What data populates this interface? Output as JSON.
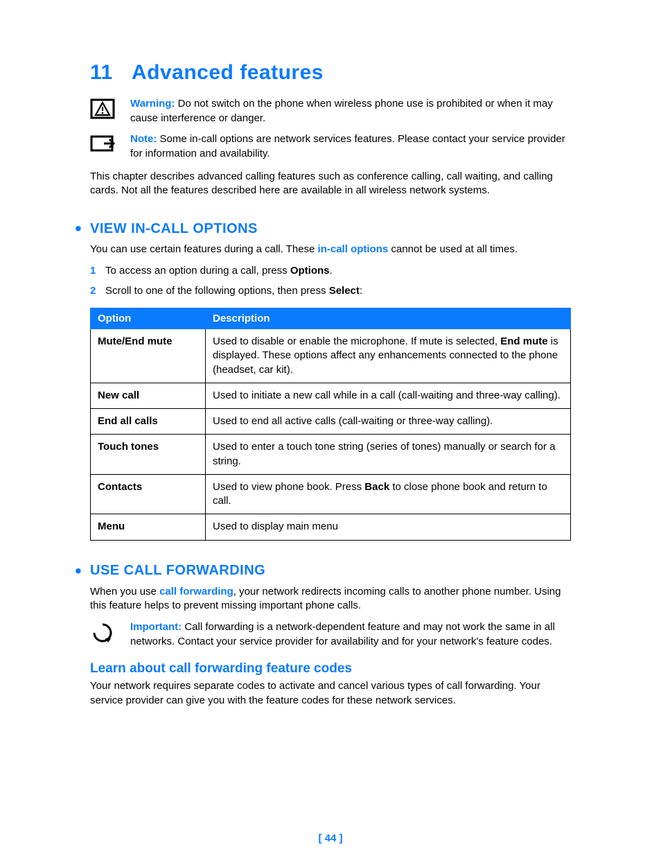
{
  "chapter": {
    "number": "11",
    "title": "Advanced features"
  },
  "warning": {
    "label": "Warning:",
    "text": " Do not switch on the phone when wireless phone use is prohibited or when it may cause interference or danger."
  },
  "note": {
    "label": "Note:",
    "text": " Some in-call options are network services features. Please contact your service provider for information and availability."
  },
  "intro": "This chapter describes advanced calling features such as conference calling, call waiting, and calling cards. Not all the features described here are available in all wireless network systems.",
  "section1": {
    "title": "VIEW IN-CALL OPTIONS",
    "body_pre": "You can use certain features during a call. These ",
    "body_term": "in-call options",
    "body_post": " cannot be used at all times.",
    "step1_pre": "To access an option during a call, press ",
    "step1_bold": "Options",
    "step1_post": ".",
    "step2_pre": "Scroll to one of the following options, then press ",
    "step2_bold": "Select",
    "step2_post": ":",
    "th_option": "Option",
    "th_desc": "Description",
    "rows": [
      {
        "name": "Mute/End mute",
        "pre": "Used to disable or enable the microphone. If mute is selected, ",
        "bold": "End mute",
        "post": " is displayed. These options affect any enhancements connected to the phone (headset, car kit)."
      },
      {
        "name": "New call",
        "pre": "Used to initiate a new call while in a call (call-waiting and three-way calling).",
        "bold": "",
        "post": ""
      },
      {
        "name": "End all calls",
        "pre": "Used to end all active calls (call-waiting or three-way calling).",
        "bold": "",
        "post": ""
      },
      {
        "name": "Touch tones",
        "pre": "Used to enter a touch tone string (series of tones) manually or search for a string.",
        "bold": "",
        "post": ""
      },
      {
        "name": "Contacts",
        "pre": "Used to view phone book. Press ",
        "bold": "Back",
        "post": " to close phone book and return to call."
      },
      {
        "name": "Menu",
        "pre": "Used to display main menu",
        "bold": "",
        "post": ""
      }
    ]
  },
  "section2": {
    "title": "USE CALL FORWARDING",
    "body_pre": "When you use ",
    "body_term": "call forwarding",
    "body_post": ", your network redirects incoming calls to another phone number. Using this feature helps to prevent missing important phone calls.",
    "important_label": "Important:",
    "important_text": " Call forwarding is a network-dependent feature and may not work the same in all networks. Contact your service provider for availability and for your network's feature codes.",
    "subhead": "Learn about call forwarding feature codes",
    "sub_body": "Your network requires separate codes to activate and cancel various types of call forwarding. Your service provider can give you with the feature codes for these network services."
  },
  "page_number": "[ 44 ]"
}
